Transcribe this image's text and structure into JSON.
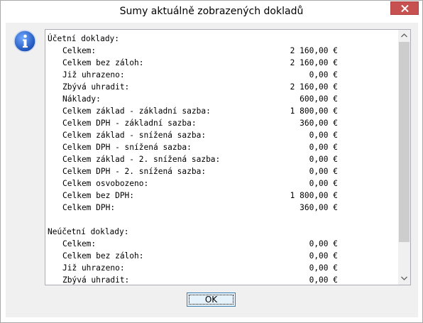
{
  "window": {
    "title": "Sumy aktuálně zobrazených dokladů",
    "close_icon": "close-icon"
  },
  "icon": {
    "name": "info-icon",
    "color": "#1f5fbf"
  },
  "lines": [
    {
      "label": "Účetní doklady:",
      "value": "",
      "indent": false
    },
    {
      "label": "Celkem:",
      "value": "2 160,00 €",
      "indent": true
    },
    {
      "label": "Celkem bez záloh:",
      "value": "2 160,00 €",
      "indent": true
    },
    {
      "label": "Již uhrazeno:",
      "value": "0,00 €",
      "indent": true
    },
    {
      "label": "Zbývá uhradit:",
      "value": "2 160,00 €",
      "indent": true
    },
    {
      "label": "Náklady:",
      "value": "600,00 €",
      "indent": true
    },
    {
      "label": "Celkem základ - základní sazba:",
      "value": "1 800,00 €",
      "indent": true
    },
    {
      "label": "Celkem DPH - základní sazba:",
      "value": "360,00 €",
      "indent": true
    },
    {
      "label": "Celkem základ - snížená sazba:",
      "value": "0,00 €",
      "indent": true
    },
    {
      "label": "Celkem DPH - snížená sazba:",
      "value": "0,00 €",
      "indent": true
    },
    {
      "label": "Celkem základ - 2. snížená sazba:",
      "value": "0,00 €",
      "indent": true
    },
    {
      "label": "Celkem DPH - 2. snížená sazba:",
      "value": "0,00 €",
      "indent": true
    },
    {
      "label": "Celkem osvobozeno:",
      "value": "0,00 €",
      "indent": true
    },
    {
      "label": "Celkem bez DPH:",
      "value": "1 800,00 €",
      "indent": true
    },
    {
      "label": "Celkem DPH:",
      "value": "360,00 €",
      "indent": true
    },
    {
      "label": "",
      "value": "",
      "indent": false
    },
    {
      "label": "Neúčetní doklady:",
      "value": "",
      "indent": false
    },
    {
      "label": "Celkem:",
      "value": "0,00 €",
      "indent": true
    },
    {
      "label": "Celkem bez záloh:",
      "value": "0,00 €",
      "indent": true
    },
    {
      "label": "Již uhrazeno:",
      "value": "0,00 €",
      "indent": true
    },
    {
      "label": "Zbývá uhradit:",
      "value": "0,00 €",
      "indent": true
    }
  ],
  "buttons": {
    "ok_label": "OK"
  }
}
